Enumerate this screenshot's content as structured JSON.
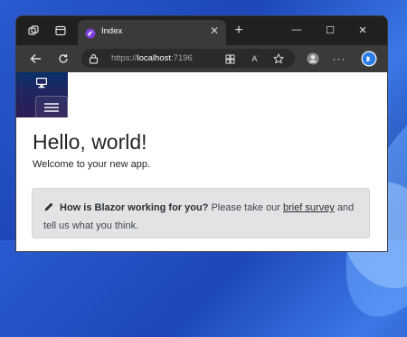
{
  "browser": {
    "tab": {
      "title": "Index",
      "close_glyph": "✕"
    },
    "new_tab_glyph": "+",
    "window_controls": {
      "minimize": "—",
      "maximize": "☐",
      "close": "✕"
    },
    "address": {
      "protocol_host": "https://",
      "host": "localhost",
      "port": ":7196"
    },
    "accent_color": "#2b7de9"
  },
  "app": {
    "brand_icon": "monitor-icon",
    "heading": "Hello, world!",
    "subtitle": "Welcome to your new app.",
    "survey": {
      "question": "How is Blazor working for you?",
      "prefix": " Please take our ",
      "link_text": "brief survey",
      "suffix": " and tell us what you think."
    }
  },
  "colors": {
    "sidebar_gradient_top": "#082f6a",
    "sidebar_gradient_bottom": "#2e1c56",
    "alert_bg": "#e2e3e5"
  }
}
